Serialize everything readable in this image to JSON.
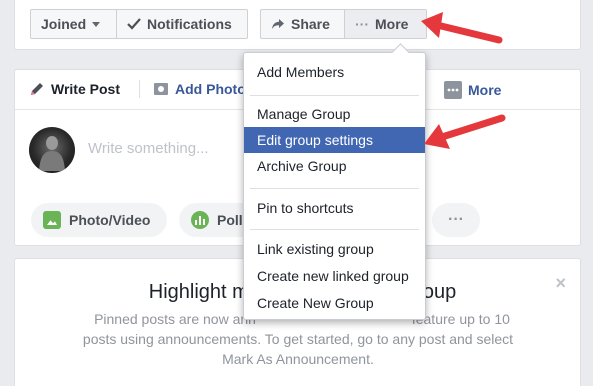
{
  "top_bar": {
    "joined_label": "Joined",
    "notifications_label": "Notifications",
    "share_label": "Share",
    "more_label": "More",
    "more_dots": "···"
  },
  "composer": {
    "tabs": {
      "write_post": "Write Post",
      "add_photo": "Add Photo",
      "more": "More"
    },
    "placeholder": "Write something...",
    "actions": {
      "photo_video": "Photo/Video",
      "poll": "Poll",
      "more_dots": "···"
    }
  },
  "highlight_card": {
    "title": "Highlight mu...",
    "title_tail": "roup",
    "body": "Pinned posts are now ann... feature up to 10 posts using announcements. To get started, go to any post and select Mark As Announcement.",
    "body_line1_left": "Pinned posts are now ann",
    "body_line1_right": "feature up to 10",
    "body_line2": "posts using announcements. To get started, go to any post and select",
    "body_line3": "Mark As Announcement.",
    "close": "×"
  },
  "dropdown": {
    "items": [
      {
        "label": "Add Members"
      },
      {
        "label": "Manage Group"
      },
      {
        "label": "Edit group settings",
        "active": true
      },
      {
        "label": "Archive Group"
      },
      {
        "label": "Pin to shortcuts"
      },
      {
        "label": "Link existing group"
      },
      {
        "label": "Create new linked group"
      },
      {
        "label": "Create New Group"
      }
    ]
  },
  "colors": {
    "accent": "#4267b2",
    "link": "#385898",
    "annotation_arrow": "#e4383d"
  }
}
